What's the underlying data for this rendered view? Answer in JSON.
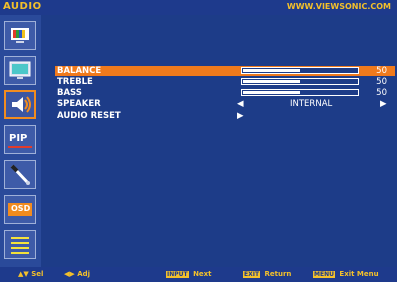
{
  "header": {
    "title": "AUDIO",
    "url": "WWW.VIEWSONIC.COM"
  },
  "sidebar": {
    "icons": [
      {
        "name": "picture-icon"
      },
      {
        "name": "display-icon"
      },
      {
        "name": "audio-icon"
      },
      {
        "name": "pip-icon",
        "label": "PIP"
      },
      {
        "name": "setup-icon"
      },
      {
        "name": "osd-icon",
        "label": "OSD"
      },
      {
        "name": "menu-icon"
      }
    ]
  },
  "menu": {
    "balance": {
      "label": "BALANCE",
      "value": "50",
      "level": 0.5
    },
    "treble": {
      "label": "TREBLE",
      "value": "50",
      "level": 0.5
    },
    "bass": {
      "label": "BASS",
      "value": "50",
      "level": 0.5
    },
    "speaker": {
      "label": "SPEAKER",
      "value": "INTERNAL"
    },
    "audio_reset": {
      "label": "AUDIO RESET"
    }
  },
  "footer": {
    "sel": "Sel",
    "adj": "Adj",
    "next_key": "INPUT",
    "next": "Next",
    "return_key": "EXIT",
    "return": "Return",
    "exit_key": "MENU",
    "exit": "Exit Menu"
  }
}
